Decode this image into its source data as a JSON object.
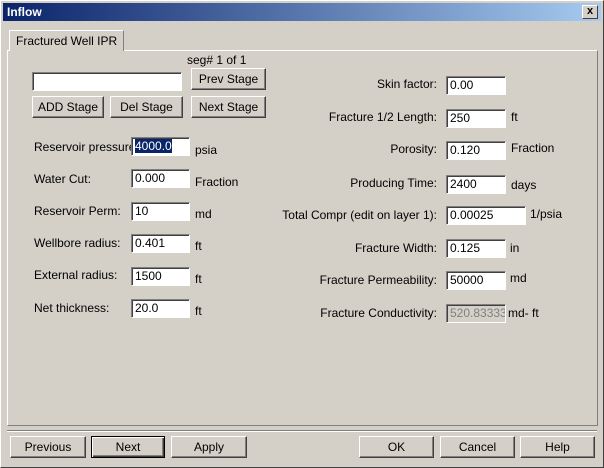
{
  "window": {
    "title": "Inflow",
    "close_label": "x"
  },
  "tab": {
    "label": "Fractured Well IPR"
  },
  "segment": {
    "label": "seg# 1 of 1",
    "name_value": "",
    "prev_stage": "Prev Stage",
    "add_stage": "ADD Stage",
    "del_stage": "Del Stage",
    "next_stage": "Next Stage"
  },
  "left_fields": [
    {
      "label": "Reservoir pressure:",
      "value": "4000.0",
      "unit": "psia"
    },
    {
      "label": "Water Cut:",
      "value": "0.000",
      "unit": "Fraction"
    },
    {
      "label": "Reservoir Perm:",
      "value": "10",
      "unit": "md"
    },
    {
      "label": "Wellbore radius:",
      "value": "0.401",
      "unit": "ft"
    },
    {
      "label": "External radius:",
      "value": "1500",
      "unit": "ft"
    },
    {
      "label": "Net thickness:",
      "value": "20.0",
      "unit": "ft"
    }
  ],
  "right_fields": [
    {
      "label": "Skin factor:",
      "value": "0.00",
      "unit": ""
    },
    {
      "label": "Fracture 1/2 Length:",
      "value": "250",
      "unit": "ft"
    },
    {
      "label": "Porosity:",
      "value": "0.120",
      "unit": "Fraction"
    },
    {
      "label": "Producing Time:",
      "value": "2400",
      "unit": "days"
    },
    {
      "label": "Total Compr (edit on layer 1):",
      "value": "0.00025",
      "unit": "1/psia"
    },
    {
      "label": "Fracture Width:",
      "value": "0.125",
      "unit": "in"
    },
    {
      "label": "Fracture Permeability:",
      "value": "50000",
      "unit": "md"
    },
    {
      "label": "Fracture Conductivity:",
      "value": "520.83333",
      "unit": "md- ft"
    }
  ],
  "footer": {
    "previous": "Previous",
    "next": "Next",
    "apply": "Apply",
    "ok": "OK",
    "cancel": "Cancel",
    "help": "Help"
  }
}
